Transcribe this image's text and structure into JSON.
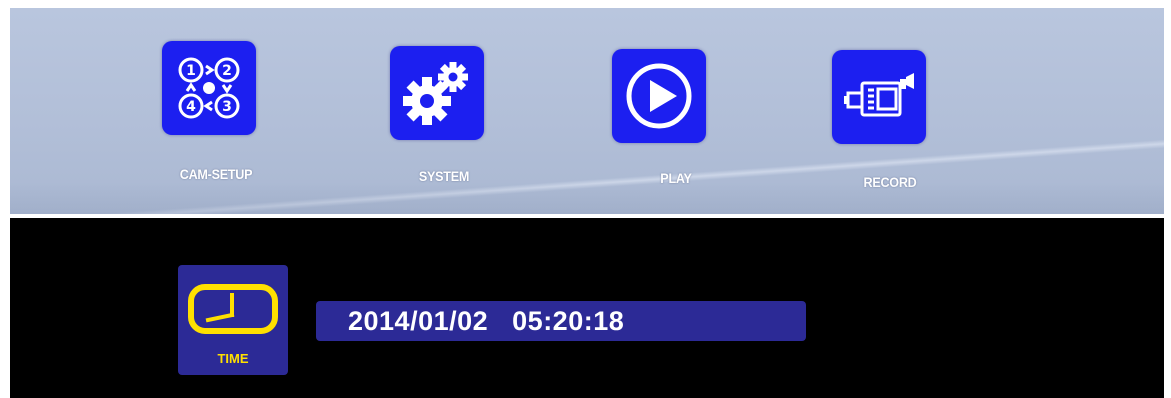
{
  "top_menu": {
    "items": [
      {
        "id": "cam-setup",
        "label": "CAM-SETUP",
        "icon": "camera-channels-icon"
      },
      {
        "id": "system",
        "label": "SYSTEM",
        "icon": "gears-icon"
      },
      {
        "id": "play",
        "label": "PLAY",
        "icon": "play-icon"
      },
      {
        "id": "record",
        "label": "RECORD",
        "icon": "video-camera-icon"
      }
    ]
  },
  "time_panel": {
    "icon": "clock-icon",
    "label": "TIME",
    "date": "2014/01/02",
    "time": "05:20:18"
  },
  "colors": {
    "tile_blue": "#1c1ff0",
    "panel_navy": "#2c2a96",
    "time_icon_yellow": "#ffe000",
    "screen_gray": "#b2bfd8"
  }
}
